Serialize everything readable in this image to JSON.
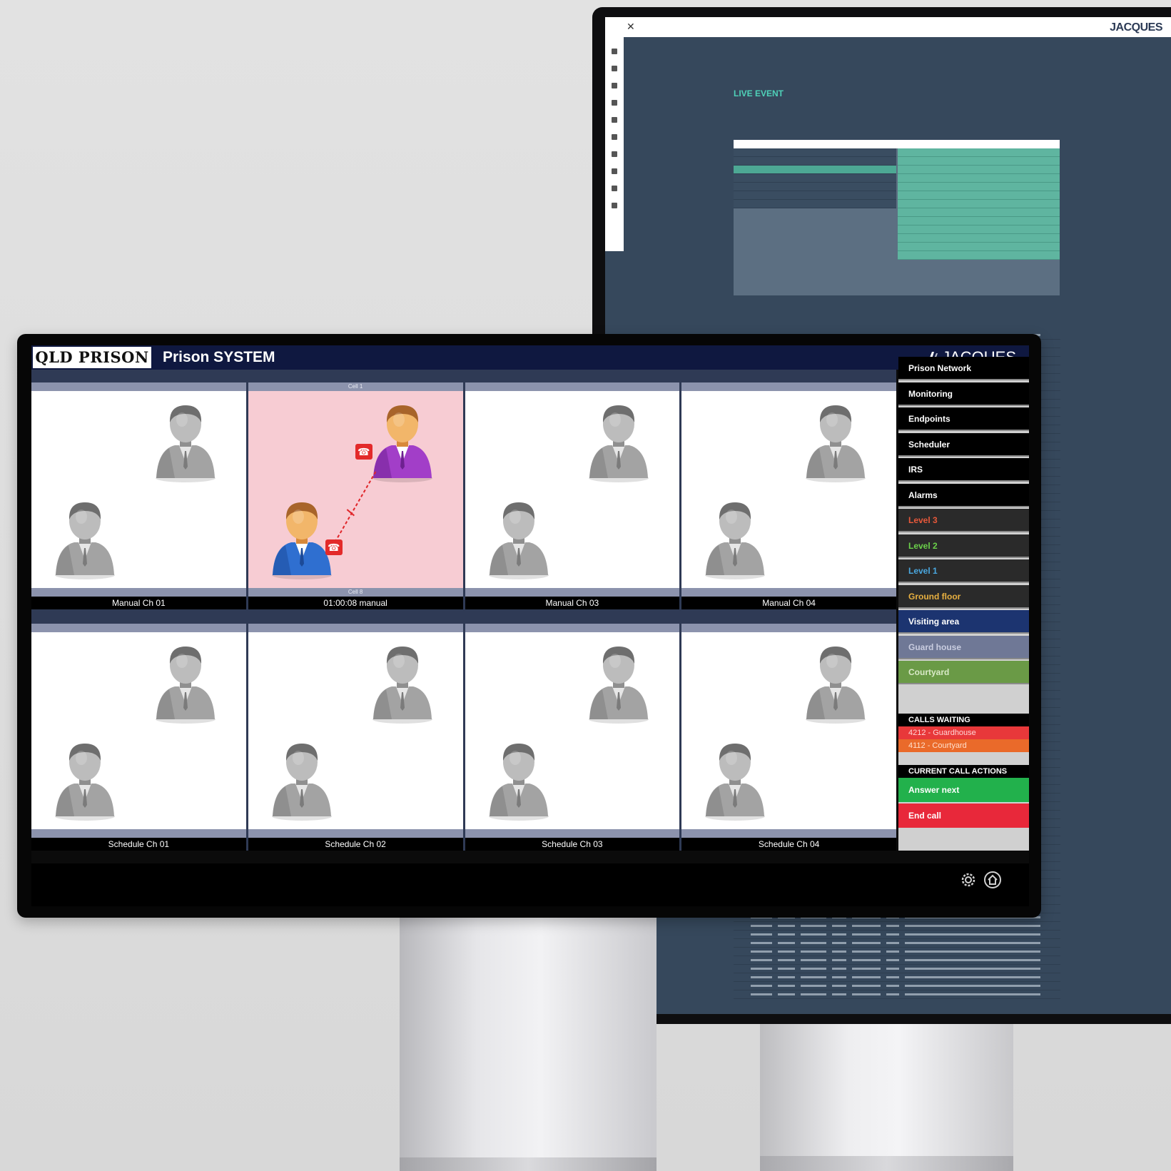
{
  "back_screen": {
    "logo": "JACQUES",
    "title": "LIVE EVENT",
    "crumbs": "",
    "section": "",
    "description": "",
    "left_list": [
      "",
      "",
      "",
      "",
      "",
      "",
      ""
    ],
    "right_list": [
      "",
      "",
      "",
      "",
      "",
      "",
      "",
      "",
      "",
      "",
      "",
      "",
      ""
    ],
    "table_label": ""
  },
  "header": {
    "brand": "QLD PRISON",
    "title": "Prison SYSTEM",
    "logo": "JACQUES"
  },
  "tiles": [
    {
      "label": "Manual Ch 01",
      "active": false
    },
    {
      "label": "01:00:08 manual",
      "active": true,
      "top_caption": "Cell 1",
      "bottom_caption": "Cell 8"
    },
    {
      "label": "Manual Ch 03",
      "active": false
    },
    {
      "label": "Manual Ch 04",
      "active": false
    },
    {
      "label": "Schedule Ch 01",
      "active": false
    },
    {
      "label": "Schedule Ch 02",
      "active": false
    },
    {
      "label": "Schedule Ch 03",
      "active": false
    },
    {
      "label": "Schedule Ch 04",
      "active": false
    }
  ],
  "menu": {
    "items": [
      {
        "label": "Prison Network",
        "bg": "#000000",
        "color": "#ffffff"
      },
      {
        "label": "Monitoring",
        "bg": "#000000",
        "color": "#ffffff"
      },
      {
        "label": "Endpoints",
        "bg": "#000000",
        "color": "#ffffff"
      },
      {
        "label": "Scheduler",
        "bg": "#000000",
        "color": "#ffffff"
      },
      {
        "label": "IRS",
        "bg": "#000000",
        "color": "#ffffff"
      },
      {
        "label": "Alarms",
        "bg": "#000000",
        "color": "#ffffff"
      },
      {
        "label": "Level 3",
        "bg": "#2a2a2a",
        "color": "#e8583a"
      },
      {
        "label": "Level 2",
        "bg": "#2a2a2a",
        "color": "#6bd14a"
      },
      {
        "label": "Level 1",
        "bg": "#2a2a2a",
        "color": "#4aa8e0"
      },
      {
        "label": "Ground floor",
        "bg": "#2a2a2a",
        "color": "#e8b040"
      },
      {
        "label": "Visiting area",
        "bg": "#1c3470",
        "color": "#ffffff"
      },
      {
        "label": "Guard house",
        "bg": "#6f7896",
        "color": "#c9cde0"
      },
      {
        "label": "Courtyard",
        "bg": "#6a9a46",
        "color": "#d9e9c7"
      }
    ],
    "calls_waiting_title": "CALLS WAITING",
    "calls_waiting": [
      {
        "text": "4212 - Guardhouse",
        "bg": "#e8383a",
        "color": "#ffd6d6"
      },
      {
        "text": "4112 - Courtyard",
        "bg": "#ea6a2a",
        "color": "#ffe0cc"
      }
    ],
    "current_actions_title": "CURRENT CALL ACTIONS",
    "answer_label": "Answer next",
    "answer_color": "#22b14c",
    "end_label": "End call",
    "end_color": "#e8283a"
  },
  "footer": {
    "icons": [
      "settings-icon",
      "home-icon"
    ]
  }
}
